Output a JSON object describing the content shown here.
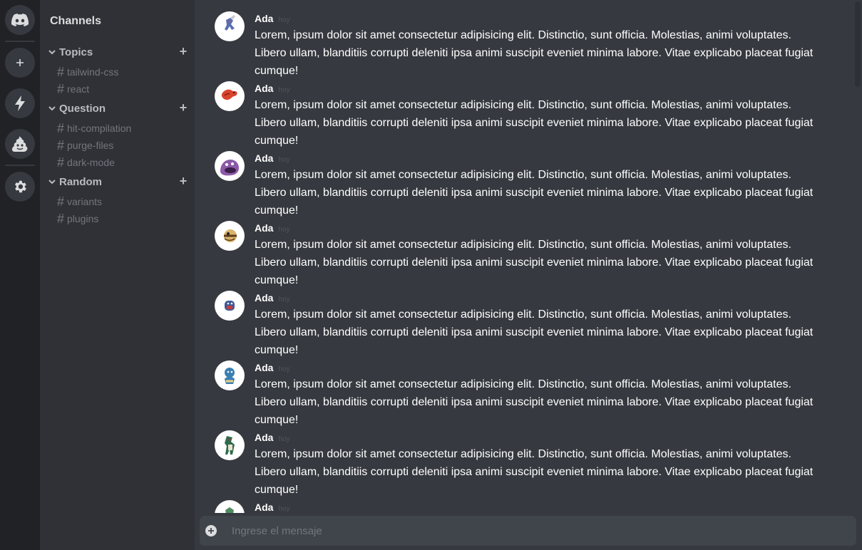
{
  "rail": {
    "items": [
      {
        "icon": "discord-logo-icon"
      },
      {
        "icon": "plus-icon"
      },
      {
        "icon": "bolt-icon"
      },
      {
        "icon": "poop-icon"
      },
      {
        "icon": "gear-icon"
      }
    ]
  },
  "sidebar": {
    "title": "Channels",
    "categories": [
      {
        "label": "Topics",
        "channels": [
          "tailwind-css",
          "react"
        ]
      },
      {
        "label": "Question",
        "channels": [
          "hit-compilation",
          "purge-files",
          "dark-mode"
        ]
      },
      {
        "label": "Random",
        "channels": [
          "variants",
          "plugins"
        ]
      }
    ],
    "hash": "#",
    "plus": "+"
  },
  "messages": [
    {
      "author": "Ada",
      "time": "hoy",
      "avatar": "pokemon-avatar-1",
      "text": "Lorem, ipsum dolor sit amet consectetur adipisicing elit. Distinctio, sunt officia. Molestias, animi voluptates. Libero ullam, blanditiis corrupti deleniti ipsa animi suscipit eveniet minima labore. Vitae explicabo placeat fugiat cumque!"
    },
    {
      "author": "Ada",
      "time": "hoy",
      "avatar": "pokemon-avatar-2",
      "text": "Lorem, ipsum dolor sit amet consectetur adipisicing elit. Distinctio, sunt officia. Molestias, animi voluptates. Libero ullam, blanditiis corrupti deleniti ipsa animi suscipit eveniet minima labore. Vitae explicabo placeat fugiat cumque!"
    },
    {
      "author": "Ada",
      "time": "hoy",
      "avatar": "pokemon-avatar-3",
      "text": "Lorem, ipsum dolor sit amet consectetur adipisicing elit. Distinctio, sunt officia. Molestias, animi voluptates. Libero ullam, blanditiis corrupti deleniti ipsa animi suscipit eveniet minima labore. Vitae explicabo placeat fugiat cumque!"
    },
    {
      "author": "Ada",
      "time": "hoy",
      "avatar": "pokemon-avatar-4",
      "text": "Lorem, ipsum dolor sit amet consectetur adipisicing elit. Distinctio, sunt officia. Molestias, animi voluptates. Libero ullam, blanditiis corrupti deleniti ipsa animi suscipit eveniet minima labore. Vitae explicabo placeat fugiat cumque!"
    },
    {
      "author": "Ada",
      "time": "hoy",
      "avatar": "pokemon-avatar-5",
      "text": "Lorem, ipsum dolor sit amet consectetur adipisicing elit. Distinctio, sunt officia. Molestias, animi voluptates. Libero ullam, blanditiis corrupti deleniti ipsa animi suscipit eveniet minima labore. Vitae explicabo placeat fugiat cumque!"
    },
    {
      "author": "Ada",
      "time": "hoy",
      "avatar": "pokemon-avatar-6",
      "text": "Lorem, ipsum dolor sit amet consectetur adipisicing elit. Distinctio, sunt officia. Molestias, animi voluptates. Libero ullam, blanditiis corrupti deleniti ipsa animi suscipit eveniet minima labore. Vitae explicabo placeat fugiat cumque!"
    },
    {
      "author": "Ada",
      "time": "hoy",
      "avatar": "pokemon-avatar-7",
      "text": "Lorem, ipsum dolor sit amet consectetur adipisicing elit. Distinctio, sunt officia. Molestias, animi voluptates. Libero ullam, blanditiis corrupti deleniti ipsa animi suscipit eveniet minima labore. Vitae explicabo placeat fugiat cumque!"
    },
    {
      "author": "Ada",
      "time": "hoy",
      "avatar": "pokemon-avatar-8",
      "text": ""
    }
  ],
  "composer": {
    "placeholder": "Ingrese el mensaje",
    "value": ""
  },
  "colors": {
    "rail_bg": "#202225",
    "sidebar_bg": "#2f3136",
    "chat_bg": "#36393f",
    "input_bg": "#40444b",
    "muted_text": "#72767d"
  }
}
